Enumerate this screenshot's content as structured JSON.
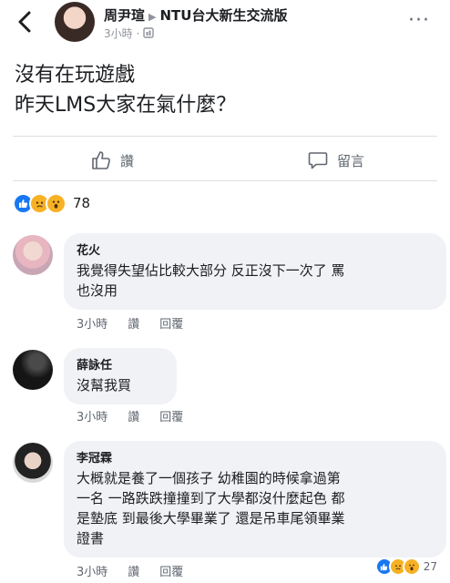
{
  "header": {
    "author": "周尹瑄",
    "group": "NTU台大新生交流版",
    "time": "3小時",
    "dot": "·",
    "more": "···"
  },
  "post": {
    "lines": [
      "沒有在玩遊戲",
      "昨天LMS大家在氣什麼？"
    ]
  },
  "actions": {
    "like_label": "讚",
    "comment_label": "留言"
  },
  "reactions": {
    "count": "78"
  },
  "comments": [
    {
      "name": "花火",
      "text_lines": [
        "我覺得失望佔比較大部分 反正沒下一次了 罵",
        "也沒用"
      ],
      "time": "3小時",
      "like": "讚",
      "reply": "回覆"
    },
    {
      "name": "薛詠任",
      "text_lines": [
        "沒幫我買"
      ],
      "time": "3小時",
      "like": "讚",
      "reply": "回覆"
    },
    {
      "name": "李冠霖",
      "text_lines": [
        "大概就是養了一個孩子 幼稚園的時候拿過第",
        "一名 一路跌跌撞撞到了大學都沒什麼起色 都",
        "是墊底 到最後大學畢業了 還是吊車尾領畢業",
        "證書"
      ],
      "time": "3小時",
      "like": "讚",
      "reply": "回覆",
      "reaction_count": "27"
    }
  ],
  "colors": {
    "text": "#1c1e21",
    "meta": "#90949c",
    "bubble": "#f0f2f5",
    "like_blue": "#1877f2",
    "emoji_yellow": "#f7b125"
  }
}
